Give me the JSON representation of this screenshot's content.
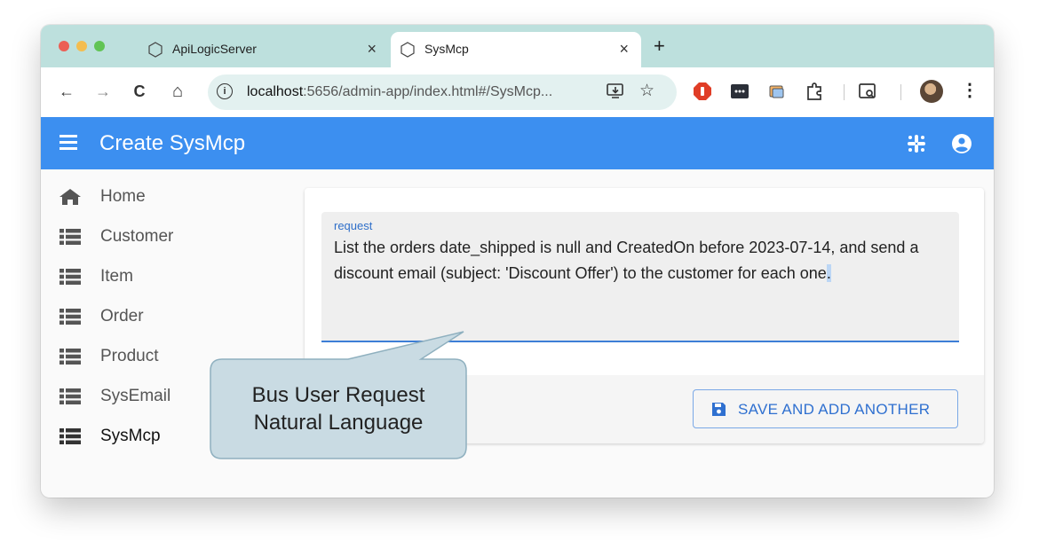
{
  "browser": {
    "tabs": [
      {
        "title": "ApiLogicServer",
        "close": "×"
      },
      {
        "title": "SysMcp",
        "close": "×"
      }
    ],
    "new_tab": "+",
    "url_host": "localhost",
    "url_rest": ":5656/admin-app/index.html#/SysMcp...",
    "info_glyph": "i",
    "star_glyph": "☆",
    "menu_glyph": "⋮",
    "nav": {
      "back": "←",
      "forward": "→",
      "reload": "C",
      "home": "⌂"
    }
  },
  "appbar": {
    "title": "Create SysMcp"
  },
  "sidebar": {
    "items": [
      {
        "label": "Home",
        "icon": "home-icon"
      },
      {
        "label": "Customer",
        "icon": "list-icon"
      },
      {
        "label": "Item",
        "icon": "list-icon"
      },
      {
        "label": "Order",
        "icon": "list-icon"
      },
      {
        "label": "Product",
        "icon": "list-icon"
      },
      {
        "label": "SysEmail",
        "icon": "list-icon"
      },
      {
        "label": "SysMcp",
        "icon": "list-icon",
        "active": true
      }
    ]
  },
  "form": {
    "field_label": "request",
    "field_value_main": "List the orders date_shipped is null and CreatedOn before 2023-07-14, and send a discount email (subject: 'Discount Offer') to the customer for each one",
    "field_value_selected": ".",
    "save_label": "SAVE AND ADD ANOTHER"
  },
  "callout": {
    "line1": "Bus User Request",
    "line2": "Natural Language"
  },
  "colors": {
    "appbar": "#3c8ff0",
    "tabstrip": "#bde0dd",
    "accent": "#2f70d0",
    "callout_fill": "#c9dbe3"
  }
}
